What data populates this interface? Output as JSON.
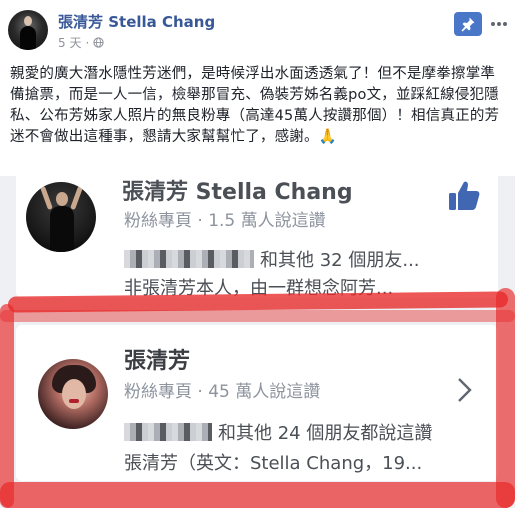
{
  "post": {
    "page_name": "張清芳 Stella Chang",
    "time": "5 天",
    "separator": "·",
    "text_main": "親愛的廣大潛水隱性芳迷們，是時候浮出水面透透氣了！但不是摩拳擦掌準備搶票，而是一人一信，檢舉那冒充、偽裝芳姊名義po文，並踩紅線侵犯隱私、公布芳姊家人照片的無良粉專（高達45萬人按讚那個）！相信真正的芳迷不會做出這種事，懇請大家幫幫忙了，感謝。",
    "text_emoji": "🙏"
  },
  "icons": {
    "avatar": "page-avatar",
    "globe": "globe-icon",
    "pin": "pin-icon",
    "more": "more-icon",
    "like": "thumbs-up-icon",
    "chevron": "chevron-right-icon"
  },
  "screenshot": {
    "cards": [
      {
        "title": "張清芳 Stella Chang",
        "subtitle": "粉絲專頁 · 1.5 萬人說這讚",
        "friends": "和其他 32 個朋友...",
        "description": "非張清芳本人，由一群想念阿芳..."
      },
      {
        "title": "張清芳",
        "subtitle": "粉絲專頁 · 45 萬人說這讚",
        "friends": "和其他 24 個朋友都說這讚",
        "description": "張清芳（英文：Stella Chang，19..."
      }
    ]
  },
  "colors": {
    "link_blue": "#385898",
    "pin_blue": "#4a76c8",
    "like_blue": "#4267b2",
    "marker_red": "#e82828",
    "emoji_gold": "#e3a326"
  }
}
